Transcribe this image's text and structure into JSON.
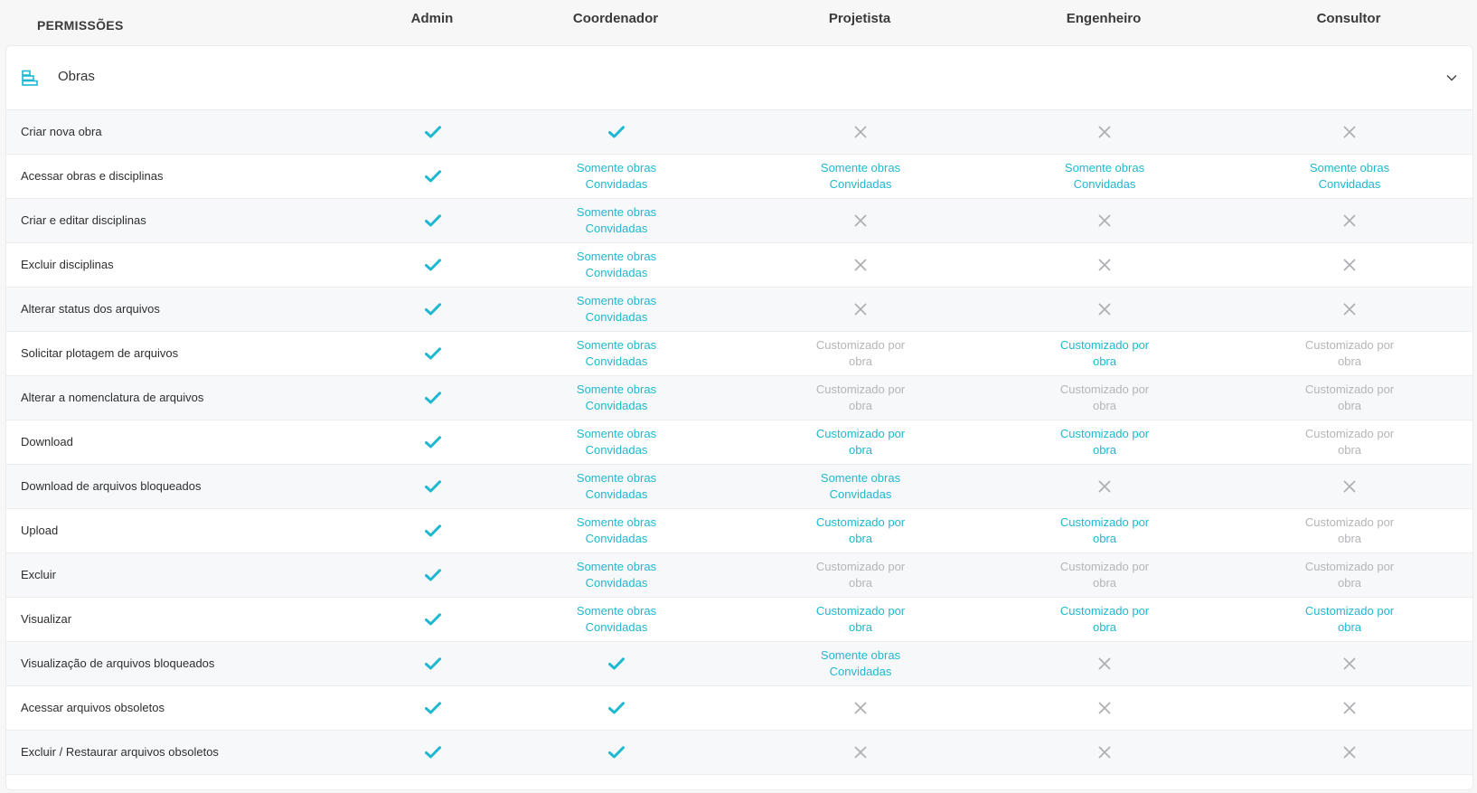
{
  "header": {
    "permissions_title": "PERMISSÕES",
    "columns": [
      "Admin",
      "Coordenador",
      "Projetista",
      "Engenheiro",
      "Consultor"
    ]
  },
  "section": {
    "label": "Obras",
    "icon": "layers-icon",
    "toggle_icon": "chevron-down-icon"
  },
  "colors": {
    "accent": "#1fb8d0",
    "muted": "#b5b5b9",
    "deny": "#b0b0b4"
  },
  "rows": [
    {
      "label": "Criar nova obra",
      "cells": [
        {
          "type": "check"
        },
        {
          "type": "check"
        },
        {
          "type": "cross"
        },
        {
          "type": "cross"
        },
        {
          "type": "cross"
        }
      ]
    },
    {
      "label": "Acessar obras e disciplinas",
      "cells": [
        {
          "type": "check"
        },
        {
          "type": "text",
          "tone": "teal",
          "l1": "Somente obras",
          "l2": "Convidadas"
        },
        {
          "type": "text",
          "tone": "teal",
          "l1": "Somente obras",
          "l2": "Convidadas"
        },
        {
          "type": "text",
          "tone": "teal",
          "l1": "Somente obras",
          "l2": "Convidadas"
        },
        {
          "type": "text",
          "tone": "teal",
          "l1": "Somente obras",
          "l2": "Convidadas"
        }
      ]
    },
    {
      "label": "Criar e editar disciplinas",
      "cells": [
        {
          "type": "check"
        },
        {
          "type": "text",
          "tone": "teal",
          "l1": "Somente obras",
          "l2": "Convidadas"
        },
        {
          "type": "cross"
        },
        {
          "type": "cross"
        },
        {
          "type": "cross"
        }
      ]
    },
    {
      "label": "Excluir disciplinas",
      "cells": [
        {
          "type": "check"
        },
        {
          "type": "text",
          "tone": "teal",
          "l1": "Somente obras",
          "l2": "Convidadas"
        },
        {
          "type": "cross"
        },
        {
          "type": "cross"
        },
        {
          "type": "cross"
        }
      ]
    },
    {
      "label": "Alterar status dos arquivos",
      "cells": [
        {
          "type": "check"
        },
        {
          "type": "text",
          "tone": "teal",
          "l1": "Somente obras",
          "l2": "Convidadas"
        },
        {
          "type": "cross"
        },
        {
          "type": "cross"
        },
        {
          "type": "cross"
        }
      ]
    },
    {
      "label": "Solicitar plotagem de arquivos",
      "cells": [
        {
          "type": "check"
        },
        {
          "type": "text",
          "tone": "teal",
          "l1": "Somente obras",
          "l2": "Convidadas"
        },
        {
          "type": "text",
          "tone": "grey",
          "l1": "Customizado por",
          "l2": "obra"
        },
        {
          "type": "text",
          "tone": "teal",
          "l1": "Customizado por",
          "l2": "obra"
        },
        {
          "type": "text",
          "tone": "grey",
          "l1": "Customizado por",
          "l2": "obra"
        }
      ]
    },
    {
      "label": "Alterar a nomenclatura de arquivos",
      "cells": [
        {
          "type": "check"
        },
        {
          "type": "text",
          "tone": "teal",
          "l1": "Somente obras",
          "l2": "Convidadas"
        },
        {
          "type": "text",
          "tone": "grey",
          "l1": "Customizado por",
          "l2": "obra"
        },
        {
          "type": "text",
          "tone": "grey",
          "l1": "Customizado por",
          "l2": "obra"
        },
        {
          "type": "text",
          "tone": "grey",
          "l1": "Customizado por",
          "l2": "obra"
        }
      ]
    },
    {
      "label": "Download",
      "cells": [
        {
          "type": "check"
        },
        {
          "type": "text",
          "tone": "teal",
          "l1": "Somente obras",
          "l2": "Convidadas"
        },
        {
          "type": "text",
          "tone": "teal",
          "l1": "Customizado por",
          "l2": "obra"
        },
        {
          "type": "text",
          "tone": "teal",
          "l1": "Customizado por",
          "l2": "obra"
        },
        {
          "type": "text",
          "tone": "grey",
          "l1": "Customizado por",
          "l2": "obra"
        }
      ]
    },
    {
      "label": "Download de arquivos bloqueados",
      "cells": [
        {
          "type": "check"
        },
        {
          "type": "text",
          "tone": "teal",
          "l1": "Somente obras",
          "l2": "Convidadas"
        },
        {
          "type": "text",
          "tone": "teal",
          "l1": "Somente obras",
          "l2": "Convidadas"
        },
        {
          "type": "cross"
        },
        {
          "type": "cross"
        }
      ]
    },
    {
      "label": "Upload",
      "cells": [
        {
          "type": "check"
        },
        {
          "type": "text",
          "tone": "teal",
          "l1": "Somente obras",
          "l2": "Convidadas"
        },
        {
          "type": "text",
          "tone": "teal",
          "l1": "Customizado por",
          "l2": "obra"
        },
        {
          "type": "text",
          "tone": "teal",
          "l1": "Customizado por",
          "l2": "obra"
        },
        {
          "type": "text",
          "tone": "grey",
          "l1": "Customizado por",
          "l2": "obra"
        }
      ]
    },
    {
      "label": "Excluir",
      "cells": [
        {
          "type": "check"
        },
        {
          "type": "text",
          "tone": "teal",
          "l1": "Somente obras",
          "l2": "Convidadas"
        },
        {
          "type": "text",
          "tone": "grey",
          "l1": "Customizado por",
          "l2": "obra"
        },
        {
          "type": "text",
          "tone": "grey",
          "l1": "Customizado por",
          "l2": "obra"
        },
        {
          "type": "text",
          "tone": "grey",
          "l1": "Customizado por",
          "l2": "obra"
        }
      ]
    },
    {
      "label": "Visualizar",
      "cells": [
        {
          "type": "check"
        },
        {
          "type": "text",
          "tone": "teal",
          "l1": "Somente obras",
          "l2": "Convidadas"
        },
        {
          "type": "text",
          "tone": "teal",
          "l1": "Customizado por",
          "l2": "obra"
        },
        {
          "type": "text",
          "tone": "teal",
          "l1": "Customizado por",
          "l2": "obra"
        },
        {
          "type": "text",
          "tone": "teal",
          "l1": "Customizado por",
          "l2": "obra"
        }
      ]
    },
    {
      "label": "Visualização de arquivos bloqueados",
      "cells": [
        {
          "type": "check"
        },
        {
          "type": "check"
        },
        {
          "type": "text",
          "tone": "teal",
          "l1": "Somente obras",
          "l2": "Convidadas"
        },
        {
          "type": "cross"
        },
        {
          "type": "cross"
        }
      ]
    },
    {
      "label": "Acessar arquivos obsoletos",
      "cells": [
        {
          "type": "check"
        },
        {
          "type": "check"
        },
        {
          "type": "cross"
        },
        {
          "type": "cross"
        },
        {
          "type": "cross"
        }
      ]
    },
    {
      "label": "Excluir / Restaurar arquivos obsoletos",
      "cells": [
        {
          "type": "check"
        },
        {
          "type": "check"
        },
        {
          "type": "cross"
        },
        {
          "type": "cross"
        },
        {
          "type": "cross"
        }
      ]
    }
  ]
}
